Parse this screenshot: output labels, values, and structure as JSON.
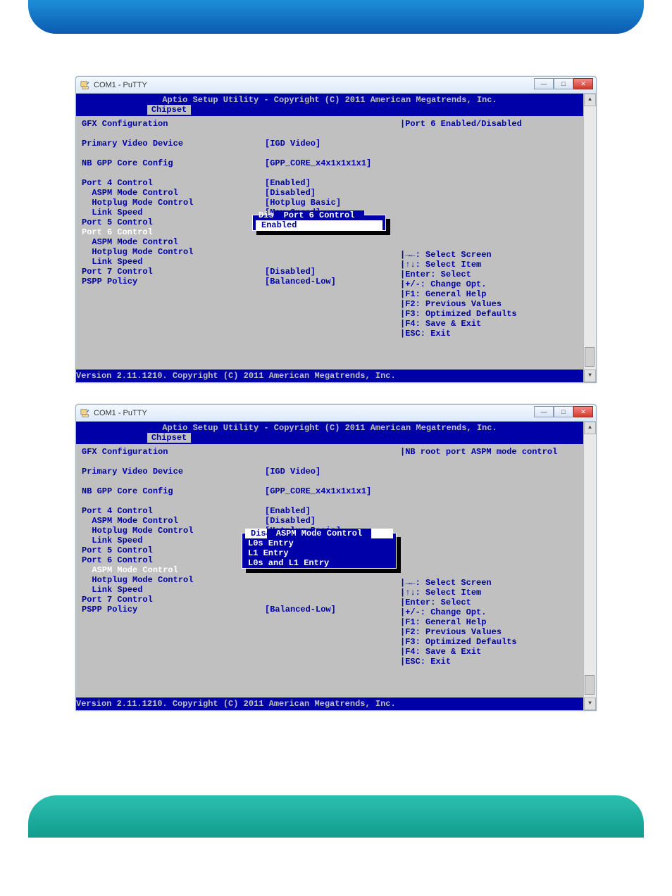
{
  "window_title": "COM1 - PuTTY",
  "header": "Aptio Setup Utility - Copyright (C) 2011 American Megatrends, Inc.",
  "tab": "Chipset",
  "page_heading": "GFX Configuration",
  "rows": [
    {
      "label": "Primary Video Device",
      "value": "[IGD Video]"
    },
    {
      "label": "NB GPP Core Config",
      "value": "[GPP_CORE_x4x1x1x1x1]"
    }
  ],
  "port4": {
    "label": "Port 4 Control",
    "value": "[Enabled]",
    "aspm_l": "  ASPM Mode Control",
    "aspm_v": "[Disabled]",
    "hot_l": "  Hotplug Mode Control",
    "hot_v": "[Hotplug Basic]",
    "link_l": "  Link Speed",
    "link_v": "[Max Speed]"
  },
  "port5": {
    "label": "Port 5 Control"
  },
  "port6": {
    "label": "Port 6 Control",
    "aspm_l": "  ASPM Mode Control",
    "hot_l": "  Hotplug Mode Control",
    "link_l": "  Link Speed"
  },
  "port7": {
    "label": "Port 7 Control",
    "value": "[Disabled]"
  },
  "pspp": {
    "label": "PSPP Policy",
    "value": "[Balanced-Low]"
  },
  "help_text_1": "Port 6 Enabled/Disabled",
  "help_text_2": "NB root port ASPM mode control",
  "keys": {
    "k1": "→←: Select Screen",
    "k2": "↑↓: Select Item",
    "k3": "Enter: Select",
    "k4": "+/-: Change Opt.",
    "k5": "F1: General Help",
    "k6": "F2: Previous Values",
    "k7": "F3: Optimized Defaults",
    "k8": "F4: Save & Exit",
    "k9": "ESC: Exit"
  },
  "footer": "Version 2.11.1210. Copyright (C) 2011 American Megatrends, Inc.",
  "popup1": {
    "title": " Port 6 Control ",
    "opts": [
      "Disabled",
      "Enabled"
    ],
    "selected": 1
  },
  "popup2": {
    "title": " ASPM Mode Control ",
    "opts": [
      "Disabled",
      "L0s Entry",
      "L1 Entry",
      "L0s and L1 Entry"
    ],
    "selected": 0
  }
}
